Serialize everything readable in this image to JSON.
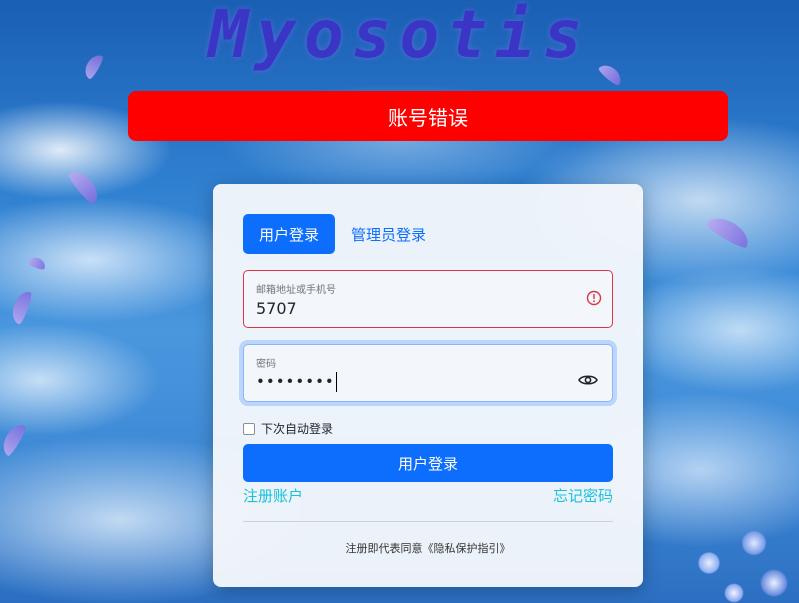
{
  "brand": {
    "title": "Myosotis"
  },
  "alert": {
    "message": "账号错误"
  },
  "login": {
    "tabs": [
      {
        "label": "用户登录",
        "active": true
      },
      {
        "label": "管理员登录",
        "active": false
      }
    ],
    "account": {
      "label": "邮箱地址或手机号",
      "value": "5707",
      "state": "invalid"
    },
    "password": {
      "label": "密码",
      "value": "••••••••"
    },
    "remember_label": "下次自动登录",
    "submit_label": "用户登录",
    "register_link": "注册账户",
    "forgot_link": "忘记密码",
    "agreement_prefix": "注册即代表同意",
    "agreement_link": "《隐私保护指引》"
  },
  "colors": {
    "primary": "#0d6efd",
    "error": "#ff0000",
    "invalid_border": "#dc3545",
    "link": "#17c2dc",
    "brand": "#3a35c4"
  },
  "icons": [
    "error-circle-icon",
    "eye-icon",
    "checkbox-icon"
  ]
}
